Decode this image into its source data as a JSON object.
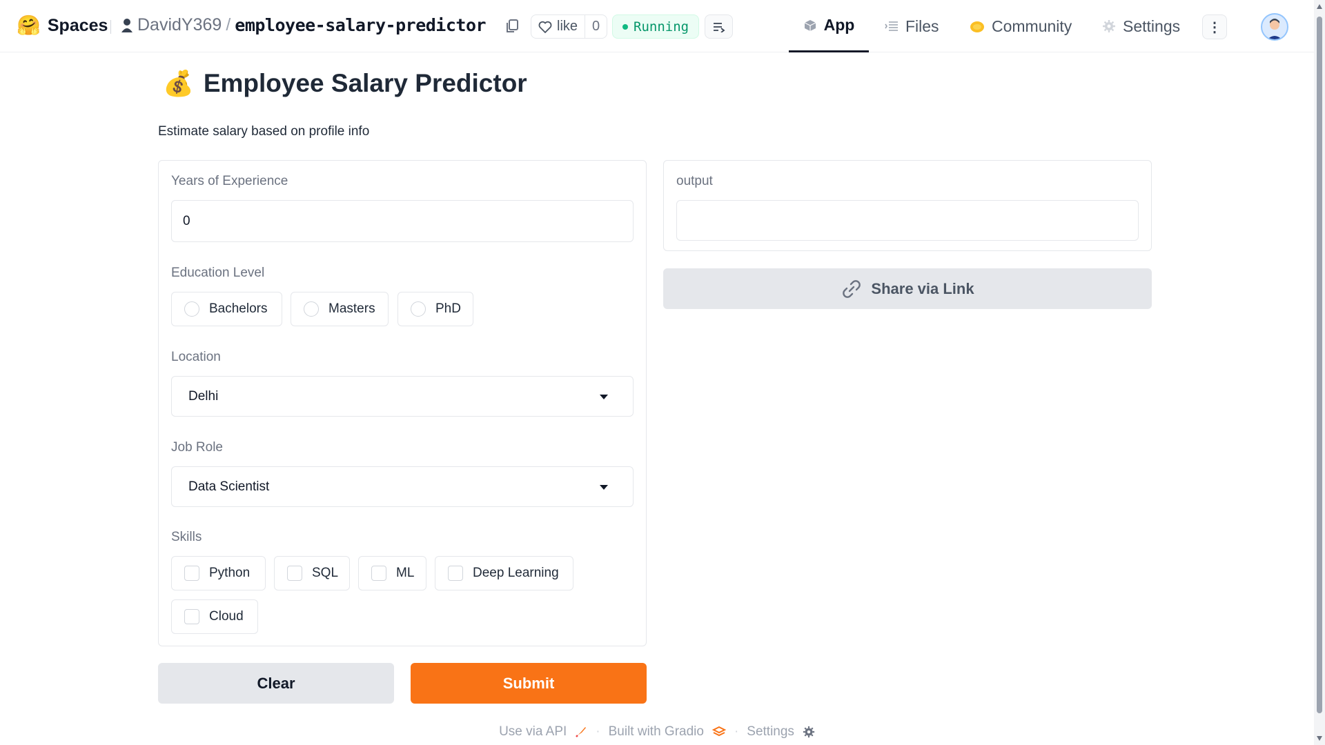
{
  "header": {
    "brand_emoji": "🤗",
    "brand_label": "Spaces",
    "owner": "DavidY369",
    "slash": "/",
    "space_name": "employee-salary-predictor",
    "like_label": "like",
    "like_count": "0",
    "status": "Running",
    "nav": [
      {
        "label": "App",
        "icon": "cube-icon"
      },
      {
        "label": "Files",
        "icon": "files-icon"
      },
      {
        "label": "Community",
        "icon": "community-icon"
      },
      {
        "label": "Settings",
        "icon": "gear-icon"
      }
    ],
    "more_label": "⋮"
  },
  "app": {
    "title_emoji": "💰",
    "title": "Employee Salary Predictor",
    "description": "Estimate salary based on profile info"
  },
  "inputs": {
    "experience": {
      "label": "Years of Experience",
      "value": "0"
    },
    "education": {
      "label": "Education Level",
      "options": [
        "Bachelors",
        "Masters",
        "PhD"
      ]
    },
    "location": {
      "label": "Location",
      "value": "Delhi"
    },
    "job_role": {
      "label": "Job Role",
      "value": "Data Scientist"
    },
    "skills": {
      "label": "Skills",
      "options": [
        "Python",
        "SQL",
        "ML",
        "Deep Learning",
        "Cloud"
      ]
    }
  },
  "output": {
    "label": "output",
    "value": ""
  },
  "buttons": {
    "share": "Share via Link",
    "clear": "Clear",
    "submit": "Submit"
  },
  "footer": {
    "api": "Use via API",
    "built": "Built with Gradio",
    "settings": "Settings",
    "separator": "·"
  },
  "colors": {
    "accent": "#f97316",
    "running": "#059669",
    "border": "#e5e7eb"
  }
}
